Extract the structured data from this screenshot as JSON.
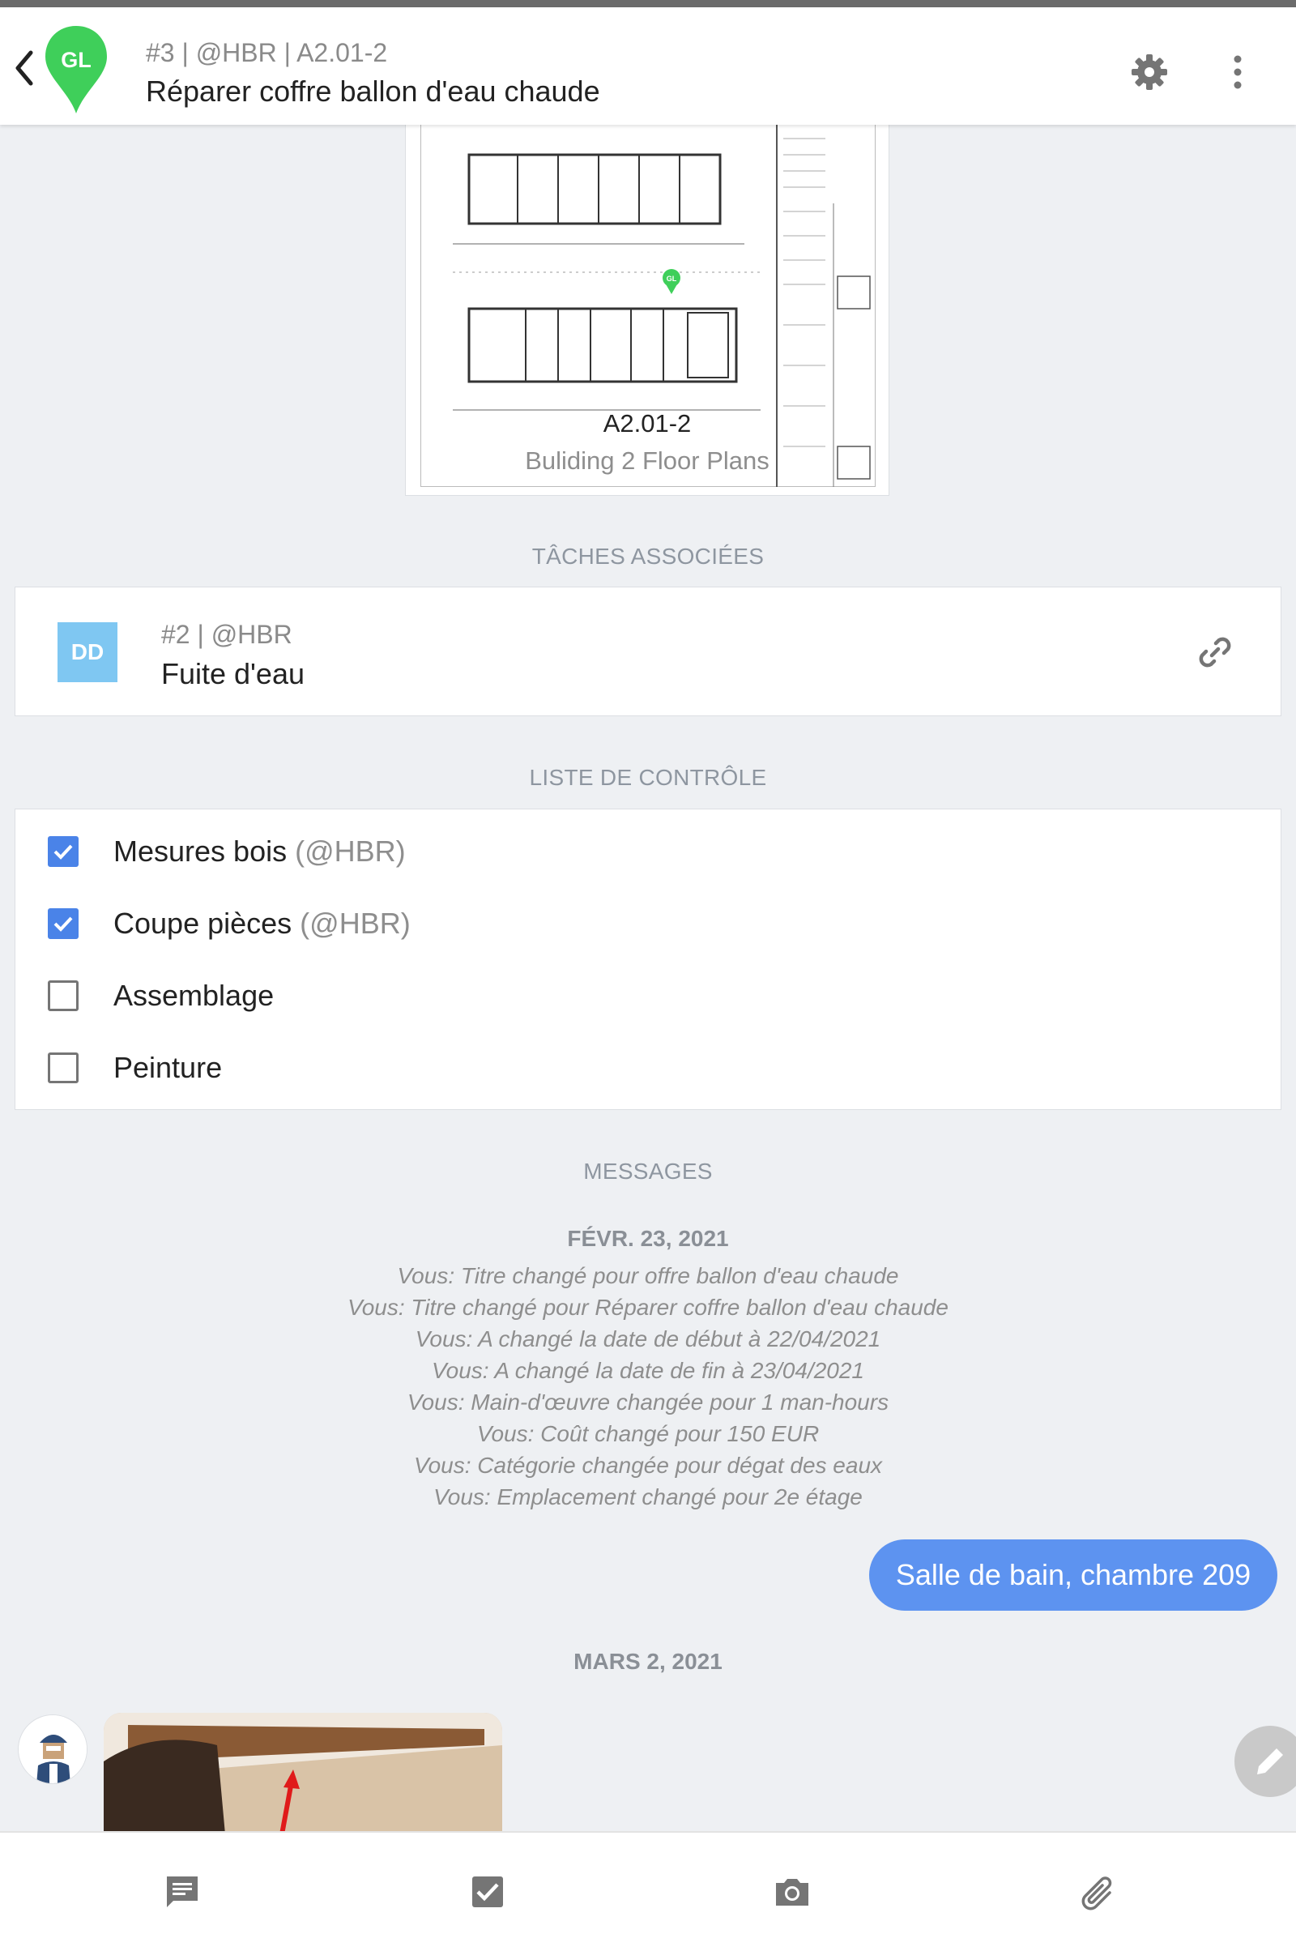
{
  "header": {
    "avatar_initials": "GL",
    "subtitle": "#3 | @HBR | A2.01-2",
    "title": "Réparer coffre ballon d'eau chaude",
    "pin_color": "#3fcf5a"
  },
  "plan": {
    "code": "A2.01-2",
    "name": "Buliding 2 Floor Plans",
    "marker_label": "GL"
  },
  "related_tasks": {
    "section_title": "TÂCHES ASSOCIÉES",
    "items": [
      {
        "avatar": "DD",
        "subtitle": "#2 | @HBR",
        "title": "Fuite d'eau"
      }
    ]
  },
  "checklist": {
    "section_title": "LISTE DE CONTRÔLE",
    "items": [
      {
        "label": "Mesures bois",
        "user": "(@HBR)",
        "checked": true
      },
      {
        "label": "Coupe pièces",
        "user": "(@HBR)",
        "checked": true
      },
      {
        "label": "Assemblage",
        "user": "",
        "checked": false
      },
      {
        "label": "Peinture",
        "user": "",
        "checked": false
      }
    ]
  },
  "messages": {
    "section_title": "MESSAGES",
    "groups": [
      {
        "date": "FÉVR. 23, 2021",
        "log": [
          "Vous: Titre changé pour offre ballon d'eau chaude",
          "Vous: Titre changé pour Réparer coffre ballon d'eau chaude",
          "Vous: A changé la date de début à 22/04/2021",
          "Vous: A changé la date de fin à 23/04/2021",
          "Vous: Main-d'œuvre changée pour 1 man-hours",
          "Vous: Coût changé pour 150 EUR",
          "Vous: Catégorie changée pour dégat des eaux",
          "Vous: Emplacement changé pour 2e étage"
        ],
        "bubble": "Salle de bain, chambre 209"
      },
      {
        "date": "MARS 2, 2021"
      }
    ]
  },
  "bottom_nav": [
    "message-icon",
    "checkbox-icon",
    "camera-icon",
    "paperclip-icon"
  ],
  "colors": {
    "accent": "#4a83e8",
    "bubble": "#5d93f0",
    "background": "#eef0f3"
  }
}
